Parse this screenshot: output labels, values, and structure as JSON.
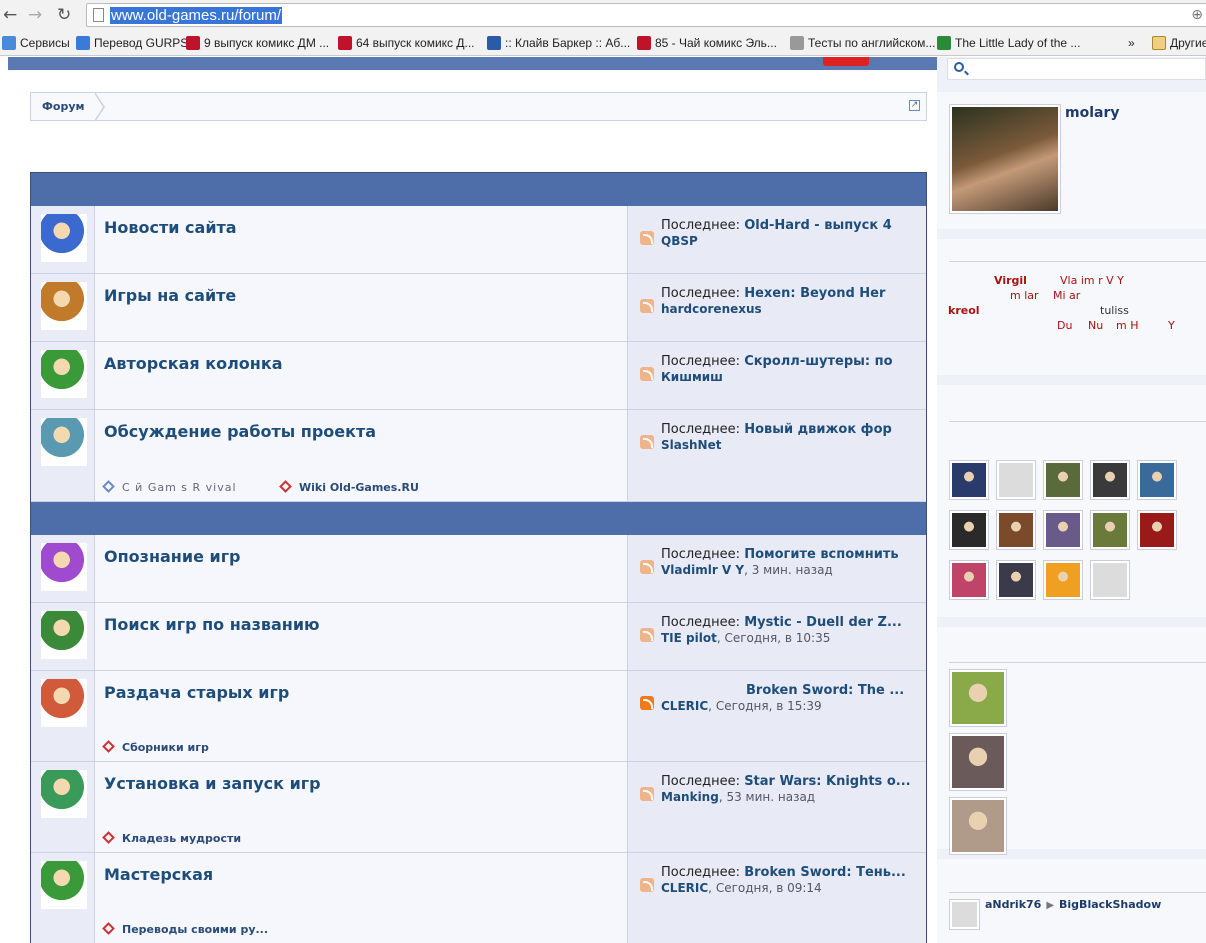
{
  "browser": {
    "url": "www.old-games.ru/forum/",
    "bookmarks": [
      {
        "label": "Сервисы",
        "color": "#4a8ad8"
      },
      {
        "label": "Перевод GURPS",
        "color": "#3a7ad8"
      },
      {
        "label": "9 выпуск комикс ДМ ...",
        "color": "#c0122a"
      },
      {
        "label": "64 выпуск комикс Д...",
        "color": "#c0122a"
      },
      {
        "label": ":: Клайв Баркер :: Аб...",
        "color": "#2a5aa8"
      },
      {
        "label": "85 - Чай комикс Эль...",
        "color": "#c0122a"
      },
      {
        "label": "Тесты по английском...",
        "color": "#999999"
      },
      {
        "label": "The Little Lady of the ...",
        "color": "#2a8a3a"
      }
    ],
    "overflow": "»",
    "other_bookmarks": "Другие"
  },
  "breadcrumb": {
    "forum": "Форум"
  },
  "forums": [
    {
      "title": "Новости сайта",
      "last_prefix": "Последнее: ",
      "last_topic": "Old-Hard - выпуск 4",
      "last_user": "QBSP",
      "last_time": "",
      "icon_color": "#3a6ad0",
      "subs": []
    },
    {
      "title": "Игры на сайте",
      "last_prefix": "Последнее: ",
      "last_topic": "Hexen: Beyond Her",
      "last_user": "hardcorenexus",
      "last_time": "",
      "icon_color": "#c07a2a",
      "subs": []
    },
    {
      "title": "Авторская колонка",
      "last_prefix": "Последнее: ",
      "last_topic": "Скролл-шутеры: по",
      "last_user": "Кишмиш",
      "last_time": "",
      "icon_color": "#3a9a3a",
      "subs": []
    },
    {
      "title": "Обсуждение работы проекта",
      "last_prefix": "Последнее: ",
      "last_topic": "Новый движок фор",
      "last_user": "SlashNet",
      "last_time": "",
      "icon_color": "#5a9ab0",
      "subs": [
        {
          "label": "С  й   Gam  s R  vival",
          "style": "grey"
        },
        {
          "label": "Wiki Old-Games.RU",
          "style": "bold"
        }
      ]
    },
    {
      "title": "Опознание игр",
      "last_prefix": "Последнее: ",
      "last_topic": "Помогите вспомнить",
      "last_user": "Vladimlr V Y",
      "last_time": "3 мин. назад",
      "icon_color": "#a04ad0",
      "subs": []
    },
    {
      "title": "Поиск игр по названию",
      "last_prefix": "Последнее: ",
      "last_topic": "Mystic - Duell der Z...",
      "last_user": "TIE pilot",
      "last_time": "Сегодня, в 10:35",
      "icon_color": "#3a8a3a",
      "subs": []
    },
    {
      "title": "Раздача старых игр",
      "last_prefix": "",
      "last_topic": "Broken Sword: The ...",
      "last_user": "CLERIC",
      "last_time": "Сегодня, в 15:39",
      "icon_color": "#d05a3a",
      "subs": [
        {
          "label": "Сборники игр",
          "style": "bold"
        }
      ]
    },
    {
      "title": "Установка и запуск игр",
      "last_prefix": "Последнее: ",
      "last_topic": "Star Wars: Knights o...",
      "last_user": "Manking",
      "last_time": "53 мин. назад",
      "icon_color": "#3a9a5a",
      "subs": [
        {
          "label": "Кладезь мудрости",
          "style": "bold"
        }
      ]
    },
    {
      "title": "Мастерская",
      "last_prefix": "Последнее: ",
      "last_topic": "Broken Sword: Тень...",
      "last_user": "CLERIC",
      "last_time": "Сегодня, в 09:14",
      "icon_color": "#3a9a3a",
      "subs": [
        {
          "label": "Переводы своими ру...",
          "style": "bold"
        }
      ]
    }
  ],
  "sidebar": {
    "user_name": "molary",
    "online": [
      {
        "text": "Virgil",
        "bold": true
      },
      {
        "text": "Vla  im r V Y",
        "bold": false
      },
      {
        "text": "m  lar",
        "bold": false
      },
      {
        "text": "Mi  ar",
        "bold": false
      },
      {
        "text": "kreol",
        "bold": true
      },
      {
        "text": "tuliss",
        "bold": false,
        "dark": true
      },
      {
        "text": "Du",
        "bold": false
      },
      {
        "text": "Nu",
        "bold": false
      },
      {
        "text": "m  H",
        "bold": false
      },
      {
        "text": "Y",
        "bold": false
      }
    ],
    "avatar_colors": [
      "#2a3a6a",
      "#dcdcdc",
      "#5a6a3a",
      "#3a3a3a",
      "#3a6a9a",
      "#2a2a2a",
      "#7a4a2a",
      "#6a5a8a",
      "#6a7a3a",
      "#9a1a1a",
      "#c0446a",
      "#3a3a4a",
      "#f0a020",
      "#dcdcdc"
    ],
    "recent_avatar_colors": [
      "#8aaa4a",
      "#6a5a5a",
      "#b09a8a"
    ],
    "last_from": "aNdrik76",
    "last_arrow": "▶",
    "last_to": "BigBlackShadow"
  }
}
